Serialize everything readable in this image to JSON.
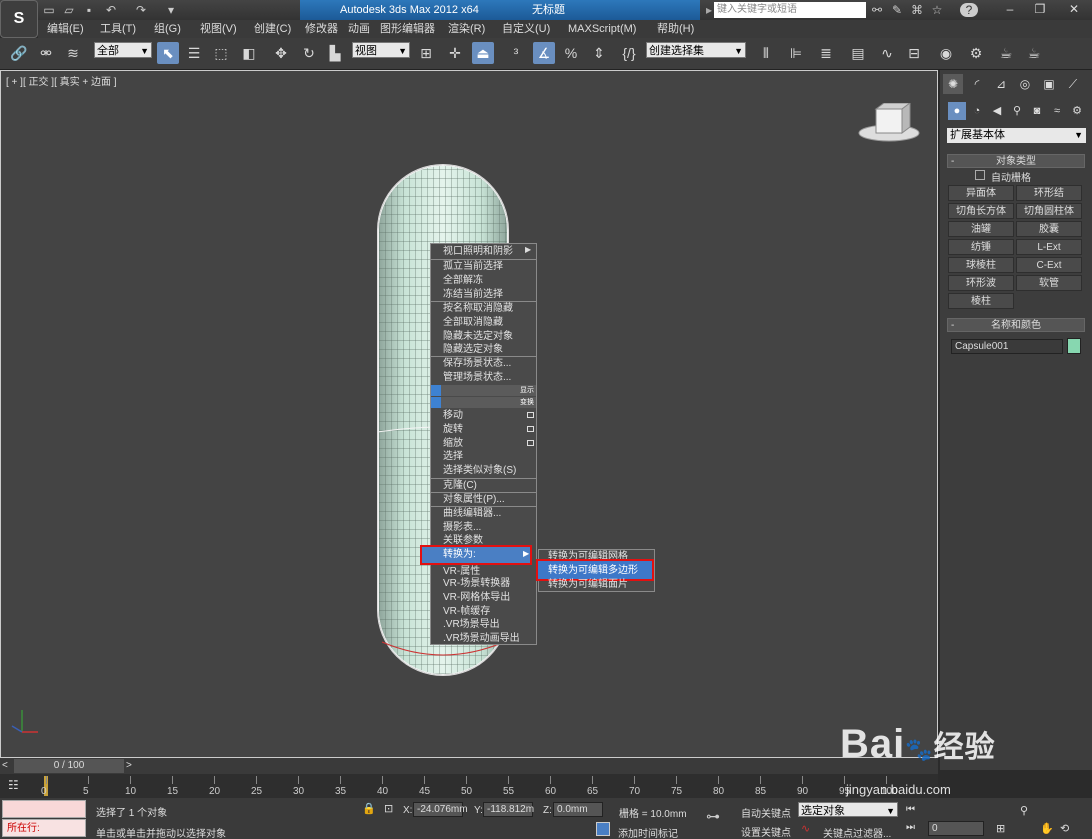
{
  "window": {
    "title": "Autodesk 3ds Max  2012 x64",
    "doc_title": "无标题",
    "search_placeholder": "键入关键字或短语"
  },
  "menu": [
    "编辑(E)",
    "工具(T)",
    "组(G)",
    "视图(V)",
    "创建(C)",
    "修改器",
    "动画",
    "图形编辑器",
    "渲染(R)",
    "自定义(U)",
    "MAXScript(M)",
    "帮助(H)"
  ],
  "toolbar": {
    "filter_select": "全部",
    "ref_coord": "视图",
    "selection_set": "创建选择集"
  },
  "viewport": {
    "label": "[ + ][ 正交 ][ 真实 + 边面 ]"
  },
  "context_menu": {
    "items": [
      {
        "label": "视口照明和阴影",
        "arrow": true
      },
      {
        "label": "孤立当前选择"
      },
      {
        "label": "全部解冻"
      },
      {
        "label": "冻结当前选择"
      },
      {
        "label": "按名称取消隐藏"
      },
      {
        "label": "全部取消隐藏"
      },
      {
        "label": "隐藏未选定对象"
      },
      {
        "label": "隐藏选定对象"
      },
      {
        "label": "保存场景状态..."
      },
      {
        "label": "管理场景状态..."
      }
    ],
    "section_display": "显示",
    "section_transform": "变换",
    "transform_items": [
      "移动",
      "旋转",
      "缩放",
      "选择",
      "选择类似对象(S)",
      "克隆(C)",
      "对象属性(P)...",
      "曲线编辑器...",
      "摄影表...",
      "关联参数"
    ],
    "convert_label": "转换为:",
    "vr_items": [
      "VR-属性",
      "VR-场景转换器",
      "VR-网格体导出",
      "VR-帧缓存",
      ".VR场景导出",
      ".VR场景动画导出"
    ],
    "submenu": [
      "转换为可编辑网格",
      "转换为可编辑多边形",
      "转换为可编辑面片"
    ]
  },
  "command_panel": {
    "category": "扩展基本体",
    "object_type_title": "对象类型",
    "autogrid": "自动栅格",
    "object_buttons": [
      "异面体",
      "环形结",
      "切角长方体",
      "切角圆柱体",
      "油罐",
      "胶囊",
      "纺锤",
      "L-Ext",
      "球棱柱",
      "C-Ext",
      "环形波",
      "软管",
      "棱柱"
    ],
    "name_color_title": "名称和颜色",
    "object_name": "Capsule001",
    "object_color": "#87d7b0"
  },
  "timeline": {
    "frame_display": "0 / 100",
    "ticks": [
      "0",
      "5",
      "10",
      "15",
      "20",
      "25",
      "30",
      "35",
      "40",
      "45",
      "50",
      "55",
      "60",
      "65",
      "70",
      "75",
      "80",
      "85",
      "90",
      "95",
      "100"
    ]
  },
  "status": {
    "maxscript_label": "所在行:",
    "selection_msg": "选择了 1 个对象",
    "prompt_msg": "单击或单击并拖动以选择对象",
    "x_label": "X:",
    "x_value": "-24.076mm",
    "y_label": "Y:",
    "y_value": "-118.812m",
    "z_label": "Z:",
    "z_value": "0.0mm",
    "grid": "栅格 = 10.0mm",
    "auto_key": "自动关键点",
    "set_key": "设置关键点",
    "selected_obj": "选定对象",
    "key_filters": "关键点过滤器...",
    "add_time_tag": "添加时间标记",
    "frame_field": "0"
  },
  "watermark": {
    "brand": "Bai",
    "brand2": "经验",
    "url": "jingyan.baidu.com"
  }
}
